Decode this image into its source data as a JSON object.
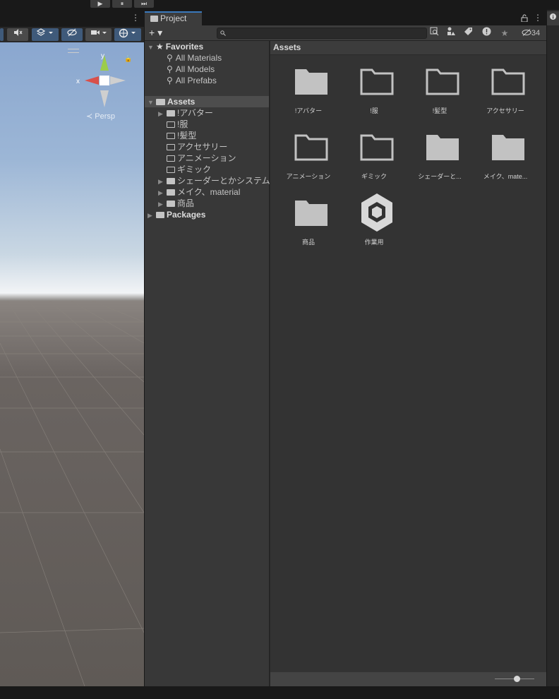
{
  "playbar": {
    "play": "▶",
    "pause": "⏸",
    "step": "⏭"
  },
  "scene": {
    "menu_icon": "⋮",
    "gizmo": {
      "x_label": "x",
      "y_label": "y"
    },
    "projection_label": "≺ Persp"
  },
  "project": {
    "tab_label": "Project",
    "lock_icon": "lock-icon",
    "menu_icon": "⋮",
    "create_label": "+ ▾",
    "search": {
      "value": "",
      "placeholder": ""
    },
    "hidden_count": "34",
    "favorites": {
      "label": "Favorites",
      "items": [
        "All Materials",
        "All Models",
        "All Prefabs"
      ]
    },
    "tree": {
      "root_label": "Assets",
      "children": [
        {
          "label": "!アバター",
          "expandable": true,
          "filled": true
        },
        {
          "label": "!服",
          "expandable": false,
          "filled": false
        },
        {
          "label": "!髪型",
          "expandable": false,
          "filled": false
        },
        {
          "label": "アクセサリー",
          "expandable": false,
          "filled": false
        },
        {
          "label": "アニメーション",
          "expandable": false,
          "filled": false
        },
        {
          "label": "ギミック",
          "expandable": false,
          "filled": false
        },
        {
          "label": "シェーダーとかシステム用",
          "expandable": true,
          "filled": true
        },
        {
          "label": "メイク、material",
          "expandable": true,
          "filled": true
        },
        {
          "label": "商品",
          "expandable": true,
          "filled": true
        }
      ],
      "packages_label": "Packages"
    },
    "breadcrumb": "Assets",
    "assets": [
      {
        "label": "!アバター",
        "type": "folder-filled"
      },
      {
        "label": "!服",
        "type": "folder-empty"
      },
      {
        "label": "!髪型",
        "type": "folder-empty"
      },
      {
        "label": "アクセサリー",
        "type": "folder-empty"
      },
      {
        "label": "アニメーション",
        "type": "folder-empty"
      },
      {
        "label": "ギミック",
        "type": "folder-empty"
      },
      {
        "label": "シェーダーと...",
        "type": "folder-filled"
      },
      {
        "label": "メイク、mate...",
        "type": "folder-filled"
      },
      {
        "label": "商品",
        "type": "folder-filled"
      },
      {
        "label": "作業用",
        "type": "unity-scene"
      }
    ],
    "zoom_level": 0.55
  },
  "inspector": {
    "icon": "info-icon"
  },
  "colors": {
    "accent": "#3a79bb",
    "panel": "#282828",
    "tree_bg": "#383838",
    "grid_bg": "#333333"
  }
}
